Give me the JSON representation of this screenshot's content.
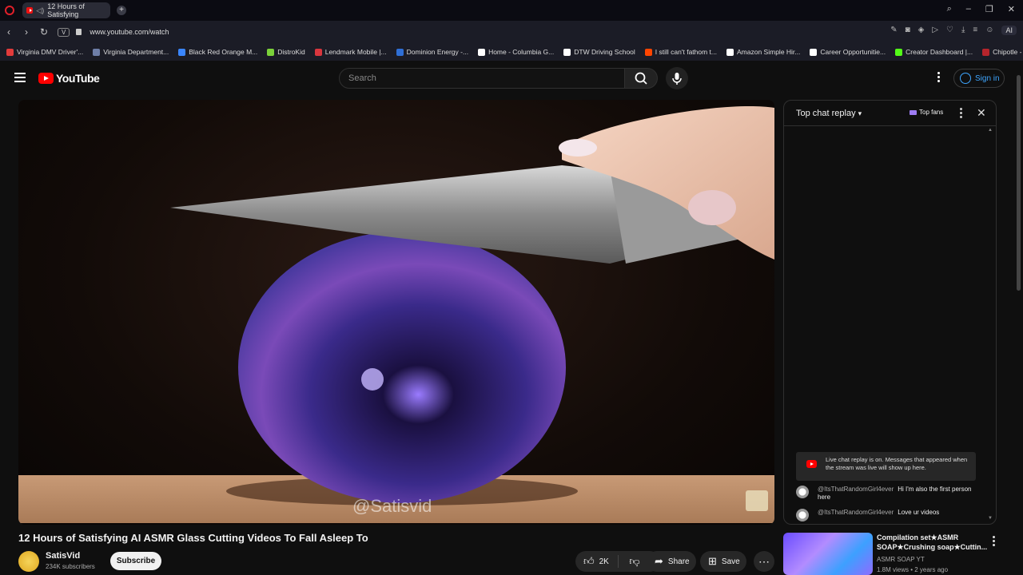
{
  "browser": {
    "tab_title": "12 Hours of Satisfying",
    "url": "www.youtube.com/watch",
    "site_badge": "V",
    "aria_label": "AI",
    "bookmarks": [
      {
        "label": "Virginia DMV Driver'...",
        "color": "#e23b3b"
      },
      {
        "label": "Virginia Department...",
        "color": "#6f7fa8"
      },
      {
        "label": "Black Red Orange M...",
        "color": "#3a86ff"
      },
      {
        "label": "DistroKid",
        "color": "#7bd13a"
      },
      {
        "label": "Lendmark Mobile |...",
        "color": "#d9363e"
      },
      {
        "label": "Dominion Energy -...",
        "color": "#2f6fd6"
      },
      {
        "label": "Home - Columbia G...",
        "color": "#ffffff"
      },
      {
        "label": "DTW Driving School",
        "color": "#ffffff"
      },
      {
        "label": "I still can't fathom t...",
        "color": "#ff4500"
      },
      {
        "label": "Amazon Simple Hir...",
        "color": "#ffffff"
      },
      {
        "label": "Career Opportunitie...",
        "color": "#ffffff"
      },
      {
        "label": "Creator Dashboard |...",
        "color": "#53fc18"
      },
      {
        "label": "Chipotle - Sign In",
        "color": "#b5252c"
      }
    ]
  },
  "header": {
    "logo_text": "YouTube",
    "search_placeholder": "Search",
    "signin_label": "Sign in"
  },
  "video": {
    "title": "12 Hours of Satisfying AI ASMR Glass Cutting Videos To Fall Asleep To",
    "watermark": "@Satisvid",
    "channel_name": "SatisVid",
    "channel_subs": "234K subscribers",
    "subscribe_label": "Subscribe",
    "like_count": "2K",
    "share_label": "Share",
    "save_label": "Save"
  },
  "chat": {
    "title": "Top chat replay",
    "top_fans_label": "Top fans",
    "replay_notice": "Live chat replay is on. Messages that appeared when the stream was live will show up here.",
    "messages": [
      {
        "author": "@ItsThatRandomGirl4ever",
        "text": "Hi I'm also the first person here"
      },
      {
        "author": "@ItsThatRandomGirl4ever",
        "text": "Love ur videos"
      }
    ]
  },
  "recommendation": {
    "title": "Compilation set★ASMR SOAP★Crushing soap★Cuttin...",
    "channel": "ASMR SOAP YT",
    "meta": "1.8M views • 2 years ago"
  },
  "colors": {
    "accent_red": "#ff0000",
    "link_blue": "#3ea6ff",
    "background": "#0f0f0f"
  }
}
